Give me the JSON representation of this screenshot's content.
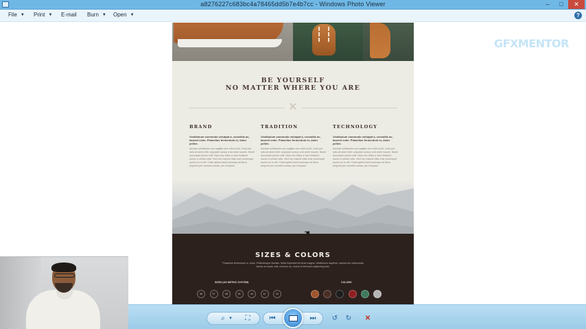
{
  "window": {
    "title": "a8276227c683bc4a78465dd5b7e4b7cc - Windows Photo Viewer",
    "controls": {
      "minimize": "–",
      "maximize": "□",
      "close": "✕"
    }
  },
  "menu": {
    "items": [
      {
        "label": "File",
        "has_dropdown": true
      },
      {
        "label": "Print",
        "has_dropdown": true
      },
      {
        "label": "E-mail",
        "has_dropdown": false
      },
      {
        "label": "Burn",
        "has_dropdown": true
      },
      {
        "label": "Open",
        "has_dropdown": true
      }
    ],
    "dropdown_glyph": "▼",
    "help_glyph": "?"
  },
  "watermark": "GFXMENTOR",
  "photo": {
    "headline_line1": "BE YOURSELF",
    "headline_line2": "NO MATTER WHERE YOU ARE",
    "columns": [
      {
        "heading": "BRAND",
        "lead": "Vestibulum commodo volutpat a, convallis ac, laoreet enim. Phasellus fermentum in, dolor pellen.",
        "body": "Aenean sollicitudin non sagittis sem nibh id elit. Duis sed odio sit amet nibh vulputate cursus a sit amet mauris. Morbi accumsan ipsum velit. Nam nec tellus a odio tincidunt auctor a ornare odio. Sed non mauris vitae erat consequat auctor eu in elit. Class aptent taciti sociosqu ad litora torquent per conubia nostra, per inceptos."
      },
      {
        "heading": "TRADITION",
        "lead": "Vestibulum commodo volutpat a, convallis ac, laoreet enim. Phasellus fermentum in, dolor pellen.",
        "body": "Aenean sollicitudin non sagittis sem nibh id elit. Duis sed odio sit amet nibh vulputate cursus a sit amet mauris. Morbi accumsan ipsum velit. Nam nec tellus a odio tincidunt auctor a ornare odio. Sed non mauris vitae erat consequat auctor eu in elit. Class aptent taciti sociosqu ad litora torquent per conubia nostra, per inceptos."
      },
      {
        "heading": "TECHNOLOGY",
        "lead": "Vestibulum commodo volutpat a, convallis ac, laoreet enim. Phasellus fermentum in, dolor pellen.",
        "body": "Aenean sollicitudin non sagittis sem nibh id elit. Duis sed odio sit amet nibh vulputate cursus a sit amet mauris. Morbi accumsan ipsum velit. Nam nec tellus a odio tincidunt auctor a ornare odio. Sed non mauris vitae erat consequat auctor eu in elit. Class aptent taciti sociosqu ad litora torquent per conubia nostra, per inceptos."
      }
    ],
    "sizes_title": "SIZES & COLORS",
    "sizes_text": "Phasellus fermentum in, dolor. Pellentesque facilisis. Nulla imperdiet sit amet magna. Vestibulum dapibus, mauris nec malesuada fames ac turpis velit, rhoncus eu, luctus et interdum adipiscing wisi.",
    "sizes_label": "SIZES (US METRIC SYSTEM)",
    "colors_label": "COLORS",
    "sizes": [
      "36",
      "37",
      "38",
      "39",
      "40",
      "41",
      "42"
    ],
    "colors": [
      "#a0562c",
      "#4a2e24",
      "#1d1d1d",
      "#8e1f22",
      "#3f7a5c",
      "#b4b4b4"
    ]
  },
  "toolbar": {
    "zoom_glyph": "⌕",
    "zoom_arrow": "▾",
    "fit_glyph": "⛶",
    "previous_glyph": "⏮",
    "next_glyph": "⏭",
    "rotate_ccw_glyph": "↺",
    "rotate_cw_glyph": "↻",
    "delete_glyph": "✕"
  }
}
